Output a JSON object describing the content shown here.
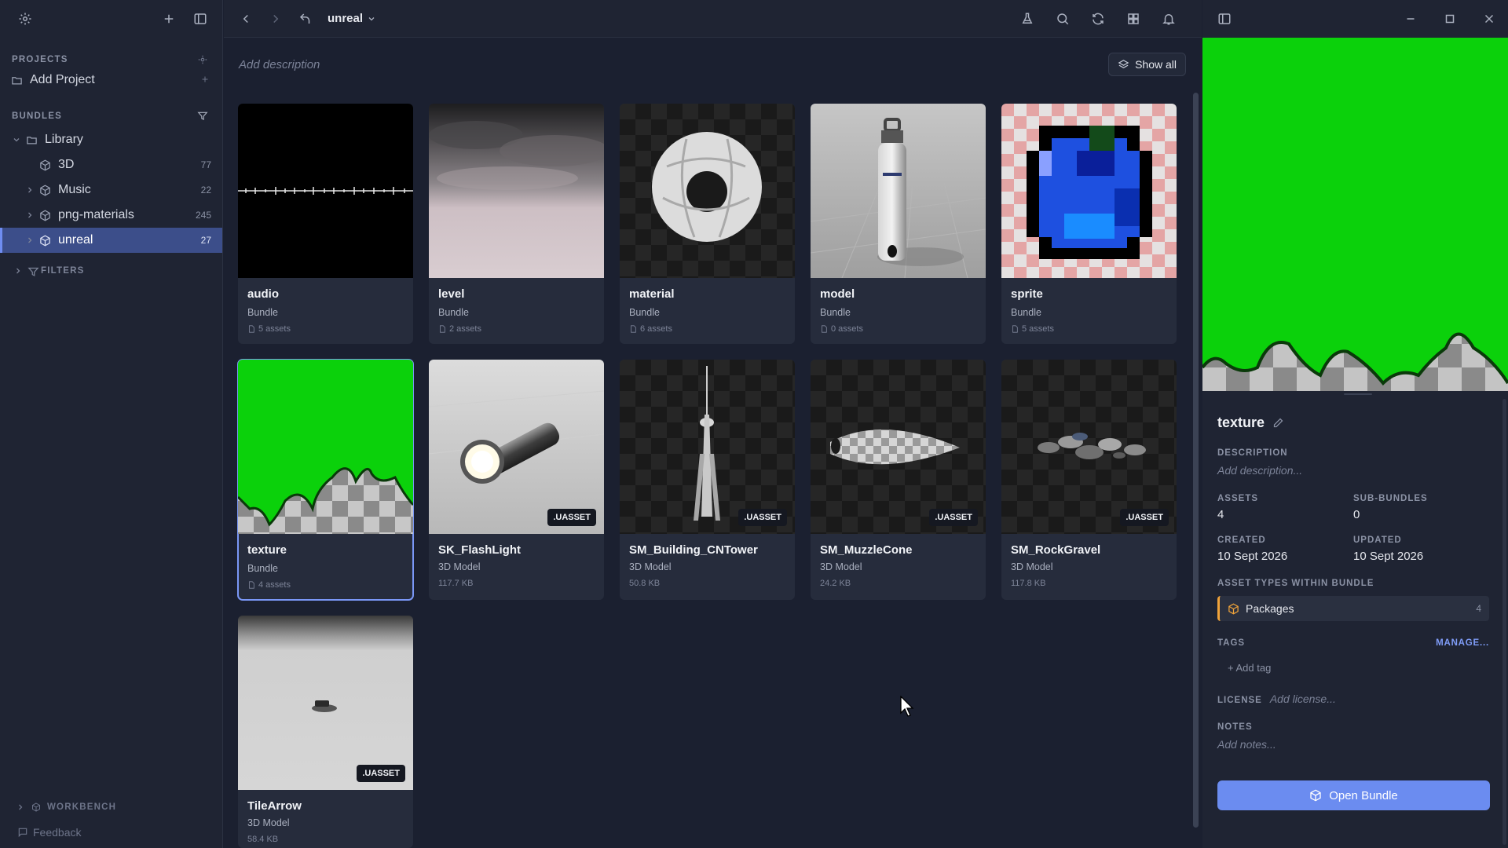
{
  "sidebar": {
    "projects_heading": "PROJECTS",
    "add_project_label": "Add Project",
    "bundles_heading": "BUNDLES",
    "tree": [
      {
        "label": "Library",
        "count": ""
      },
      {
        "label": "3D",
        "count": "77"
      },
      {
        "label": "Music",
        "count": "22"
      },
      {
        "label": "png-materials",
        "count": "245"
      },
      {
        "label": "unreal",
        "count": "27"
      }
    ],
    "filters_label": "FILTERS",
    "workbench_label": "WORKBENCH",
    "feedback_label": "Feedback"
  },
  "toolbar": {
    "breadcrumb": "unreal"
  },
  "main": {
    "description_placeholder": "Add description",
    "show_all_label": "Show all",
    "cards": [
      {
        "title": "audio",
        "type": "Bundle",
        "meta": "5 assets",
        "badge": ""
      },
      {
        "title": "level",
        "type": "Bundle",
        "meta": "2 assets",
        "badge": ""
      },
      {
        "title": "material",
        "type": "Bundle",
        "meta": "6 assets",
        "badge": ""
      },
      {
        "title": "model",
        "type": "Bundle",
        "meta": "0 assets",
        "badge": ""
      },
      {
        "title": "sprite",
        "type": "Bundle",
        "meta": "5 assets",
        "badge": ""
      },
      {
        "title": "texture",
        "type": "Bundle",
        "meta": "4 assets",
        "badge": ""
      },
      {
        "title": "SK_FlashLight",
        "type": "3D Model",
        "meta": "117.7 KB",
        "badge": ".UASSET"
      },
      {
        "title": "SM_Building_CNTower",
        "type": "3D Model",
        "meta": "50.8 KB",
        "badge": ".UASSET"
      },
      {
        "title": "SM_MuzzleCone",
        "type": "3D Model",
        "meta": "24.2 KB",
        "badge": ".UASSET"
      },
      {
        "title": "SM_RockGravel",
        "type": "3D Model",
        "meta": "117.8 KB",
        "badge": ".UASSET"
      },
      {
        "title": "TileArrow",
        "type": "3D Model",
        "meta": "58.4 KB",
        "badge": ".UASSET"
      }
    ]
  },
  "panel": {
    "title": "texture",
    "description_label": "DESCRIPTION",
    "description_placeholder": "Add description...",
    "assets_label": "ASSETS",
    "assets_value": "4",
    "subbundles_label": "SUB-BUNDLES",
    "subbundles_value": "0",
    "created_label": "CREATED",
    "created_value": "10 Sept 2026",
    "updated_label": "UPDATED",
    "updated_value": "10 Sept 2026",
    "asset_types_label": "ASSET TYPES WITHIN BUNDLE",
    "asset_type": {
      "label": "Packages",
      "count": "4",
      "color": "#f0a33a"
    },
    "tags_label": "TAGS",
    "manage_label": "MANAGE...",
    "add_tag_label": "+ Add tag",
    "license_label": "LICENSE",
    "license_placeholder": "Add license...",
    "notes_label": "NOTES",
    "notes_placeholder": "Add notes...",
    "open_button_label": "Open Bundle"
  },
  "colors": {
    "accent": "#6b8cf0",
    "selected_nav": "#3c4e8a",
    "packages": "#f0a33a"
  }
}
